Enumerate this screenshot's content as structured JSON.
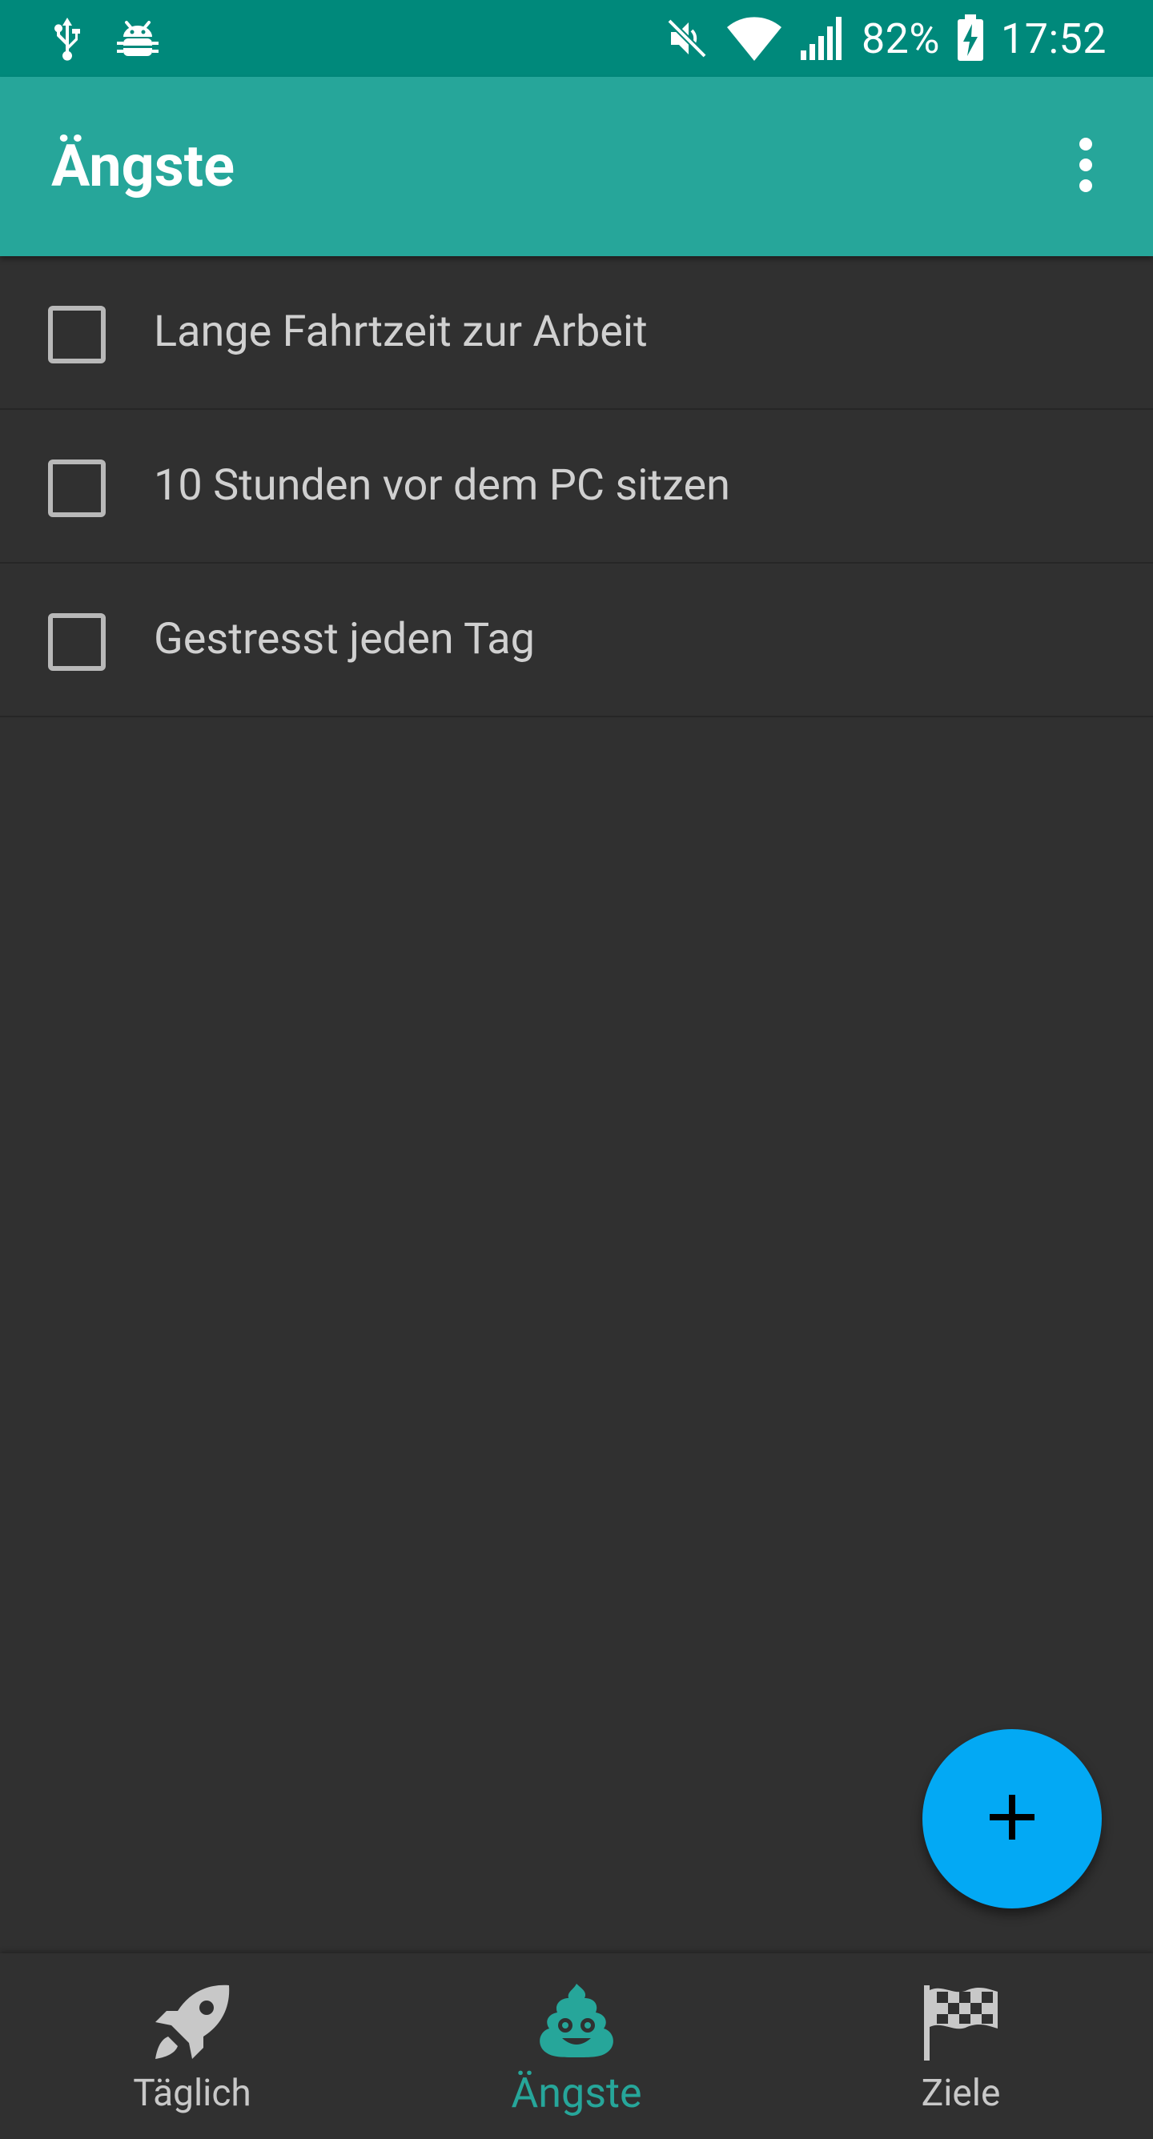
{
  "status_bar": {
    "battery_percent": "82%",
    "time": "17:52",
    "left_icons": [
      "usb-icon",
      "android-debug-icon"
    ],
    "right_icons": [
      "mute-icon",
      "wifi-icon",
      "signal-icon",
      "battery-charging-icon"
    ]
  },
  "app_bar": {
    "title": "Ängste",
    "overflow_icon": "more-vert-icon"
  },
  "list": {
    "items": [
      {
        "label": "Lange Fahrtzeit zur Arbeit",
        "checked": false
      },
      {
        "label": "10 Stunden vor dem PC sitzen",
        "checked": false
      },
      {
        "label": "Gestresst jeden Tag",
        "checked": false
      }
    ]
  },
  "fab": {
    "icon": "plus-icon",
    "color": "#03A9F4"
  },
  "bottom_nav": {
    "items": [
      {
        "label": "Täglich",
        "icon": "rocket-icon",
        "active": false
      },
      {
        "label": "Ängste",
        "icon": "poop-icon",
        "active": true
      },
      {
        "label": "Ziele",
        "icon": "checkered-flag-icon",
        "active": false
      }
    ]
  },
  "colors": {
    "status_bar": "#00897B",
    "app_bar": "#26A69A",
    "background": "#303030",
    "accent": "#26A69A",
    "fab": "#03A9F4"
  }
}
